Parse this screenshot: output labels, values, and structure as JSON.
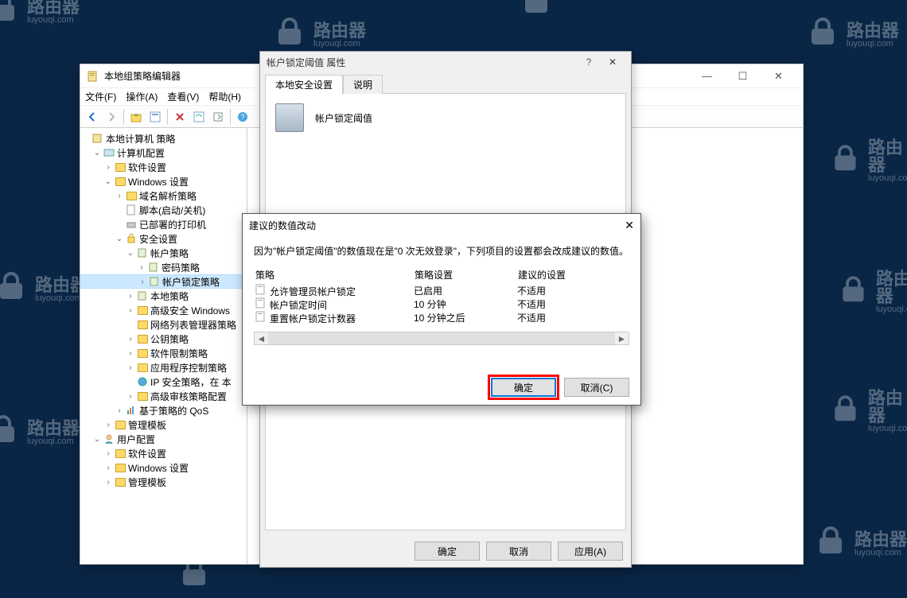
{
  "watermark": {
    "line1": "路由器",
    "line2": "luyouqi.com"
  },
  "main_window": {
    "title": "本地组策略编辑器",
    "menu": {
      "file": "文件(F)",
      "action": "操作(A)",
      "view": "查看(V)",
      "help": "帮助(H)"
    },
    "window_controls": {
      "min": "—",
      "max": "☐",
      "close": "✕"
    }
  },
  "tree": {
    "root": "本地计算机 策略",
    "computer_config": "计算机配置",
    "software_settings": "软件设置",
    "windows_settings": "Windows 设置",
    "dns_policy": "域名解析策略",
    "scripts": "脚本(启动/关机)",
    "printers": "已部署的打印机",
    "security": "安全设置",
    "account_policy": "帐户策略",
    "password_policy": "密码策略",
    "lockout_policy": "帐户锁定策略",
    "local_policy": "本地策略",
    "wfas": "高级安全 Windows",
    "network_list": "网络列表管理器策略",
    "pubkey": "公钥策略",
    "srp": "软件限制策略",
    "appctrl": "应用程序控制策略",
    "ipsec": "IP 安全策略，在 本",
    "audit": "高级审核策略配置",
    "qos": "基于策略的 QoS",
    "admin_templates": "管理模板",
    "user_config": "用户配置",
    "user_software": "软件设置",
    "user_windows": "Windows 设置",
    "user_admin": "管理模板"
  },
  "properties_dialog": {
    "title": "帐户锁定阈值 属性",
    "tab_local": "本地安全设置",
    "tab_explain": "说明",
    "policy_name": "帐户锁定阈值",
    "buttons": {
      "ok": "确定",
      "cancel": "取消",
      "apply": "应用(A)"
    }
  },
  "suggest_dialog": {
    "title": "建议的数值改动",
    "message": "因为\"帐户锁定阈值\"的数值现在是\"0 次无效登录\"，下列项目的设置都会改成建议的数值。",
    "headers": {
      "policy": "策略",
      "setting": "策略设置",
      "suggested": "建议的设置"
    },
    "rows": [
      {
        "policy": "允许管理员帐户锁定",
        "setting": "已启用",
        "suggested": "不适用"
      },
      {
        "policy": "帐户锁定时间",
        "setting": "10 分钟",
        "suggested": "不适用"
      },
      {
        "policy": "重置帐户锁定计数器",
        "setting": "10 分钟之后",
        "suggested": "不适用"
      }
    ],
    "buttons": {
      "ok": "确定",
      "cancel": "取消(C)"
    }
  }
}
